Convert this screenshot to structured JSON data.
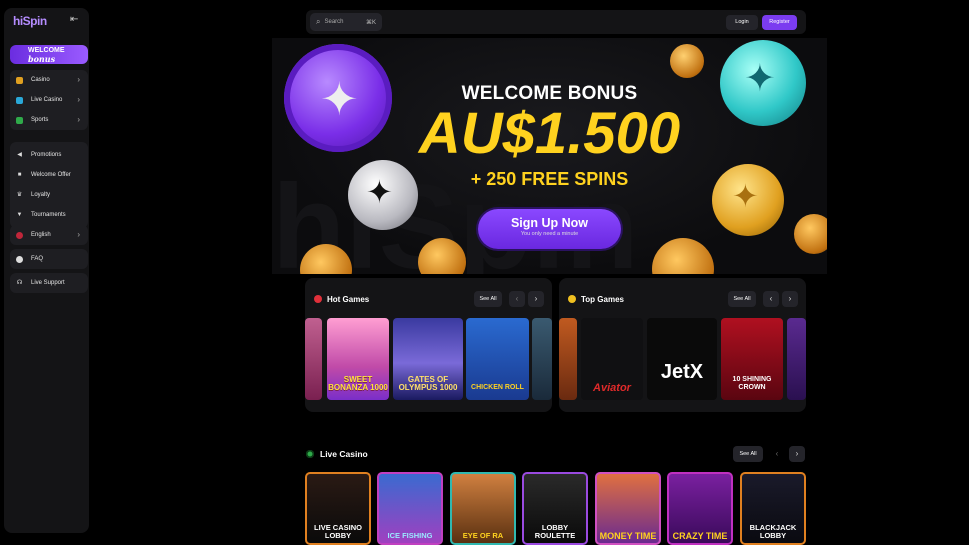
{
  "sidebar": {
    "logo": "hiSpin",
    "welcome_banner": {
      "line1": "WELCOME",
      "line2": "bonus"
    },
    "group1": [
      {
        "label": "Casino",
        "icon": "slot-icon"
      },
      {
        "label": "Live Casino",
        "icon": "live-icon"
      },
      {
        "label": "Sports",
        "icon": "sports-icon"
      }
    ],
    "group2": [
      {
        "label": "Promotions",
        "icon": "megaphone-icon"
      },
      {
        "label": "Welcome Offer",
        "icon": "gift-icon"
      },
      {
        "label": "Loyalty",
        "icon": "crown-icon"
      },
      {
        "label": "Tournaments",
        "icon": "trophy-icon"
      }
    ],
    "language": "English",
    "faq": "FAQ",
    "support": "Live Support"
  },
  "header": {
    "search_placeholder": "Search",
    "search_shortcut": "⌘K",
    "login": "Login",
    "register": "Register"
  },
  "hero": {
    "title": "WELCOME BONUS",
    "amount": "AU$1.500",
    "spins": "+ 250 FREE SPINS",
    "cta": "Sign Up Now",
    "cta_sub": "You only need a minute",
    "bg_letters": "hiSpin"
  },
  "hot_games": {
    "title": "Hot Games",
    "see_all": "See All",
    "games": [
      "SWEET BONANZA 1000",
      "GATES OF OLYMPUS 1000",
      "CHICKEN ROLL"
    ]
  },
  "top_games": {
    "title": "Top Games",
    "see_all": "See All",
    "games": [
      "Aviator",
      "JetX",
      "10 SHINING CROWN"
    ]
  },
  "live_casino": {
    "title": "Live Casino",
    "see_all": "See All",
    "games": [
      "LIVE CASINO LOBBY",
      "ICE FISHING",
      "EYE OF RA",
      "LOBBY ROULETTE",
      "MONEY TIME",
      "CRAZY TIME",
      "BLACKJACK LOBBY"
    ]
  },
  "colors": {
    "accent": "#7b3cf0",
    "gold": "#ffd21f",
    "panel": "#141416"
  }
}
